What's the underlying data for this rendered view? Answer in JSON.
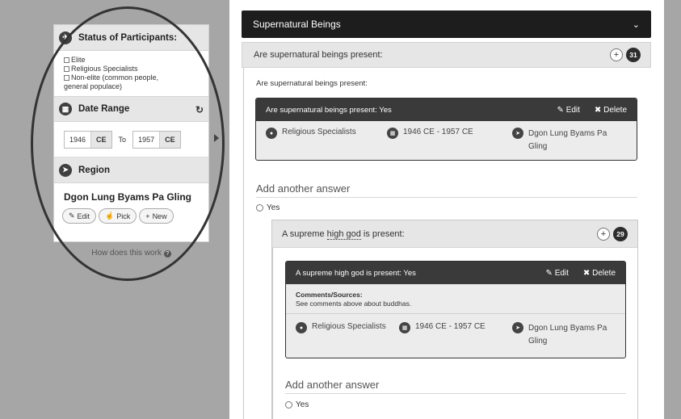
{
  "sidebar": {
    "participants_title": "Status of Participants:",
    "participants": [
      "Elite",
      "Religious Specialists",
      "Non-elite (common people,",
      "general populace)"
    ],
    "date_title": "Date Range",
    "date_from": "1946",
    "date_from_era": "CE",
    "date_to_label": "To",
    "date_to": "1957",
    "date_to_era": "CE",
    "region_title": "Region",
    "region_name": "Dgon Lung Byams Pa Gling",
    "edit_label": "Edit",
    "pick_label": "Pick",
    "new_label": "New",
    "how_label": "How does this work"
  },
  "main": {
    "section_title": "Supernatural Beings",
    "question1": {
      "title": "Are supernatural beings present:",
      "count": "31",
      "prompt": "Are supernatural beings present:",
      "answer_head": "Are supernatural beings present: Yes",
      "edit_label": "Edit",
      "delete_label": "Delete",
      "meta_participant": "Religious Specialists",
      "meta_date": "1946 CE - 1957 CE",
      "meta_region_line1": "Dgon Lung Byams Pa",
      "meta_region_line2": "Gling"
    },
    "add_answer_label": "Add another answer",
    "yes_label": "Yes",
    "question2": {
      "title_prefix": "A supreme ",
      "title_link": "high god",
      "title_suffix": " is present:",
      "count": "29",
      "answer_head": "A supreme high god is present: Yes",
      "edit_label": "Edit",
      "delete_label": "Delete",
      "comments_label": "Comments/Sources:",
      "comments_text": "See comments above about buddhas.",
      "meta_participant": "Religious Specialists",
      "meta_date": "1946 CE - 1957 CE",
      "meta_region_line1": "Dgon Lung Byams Pa",
      "meta_region_line2": "Gling"
    },
    "add_answer_label2": "Add another answer",
    "yes_label2": "Yes"
  }
}
